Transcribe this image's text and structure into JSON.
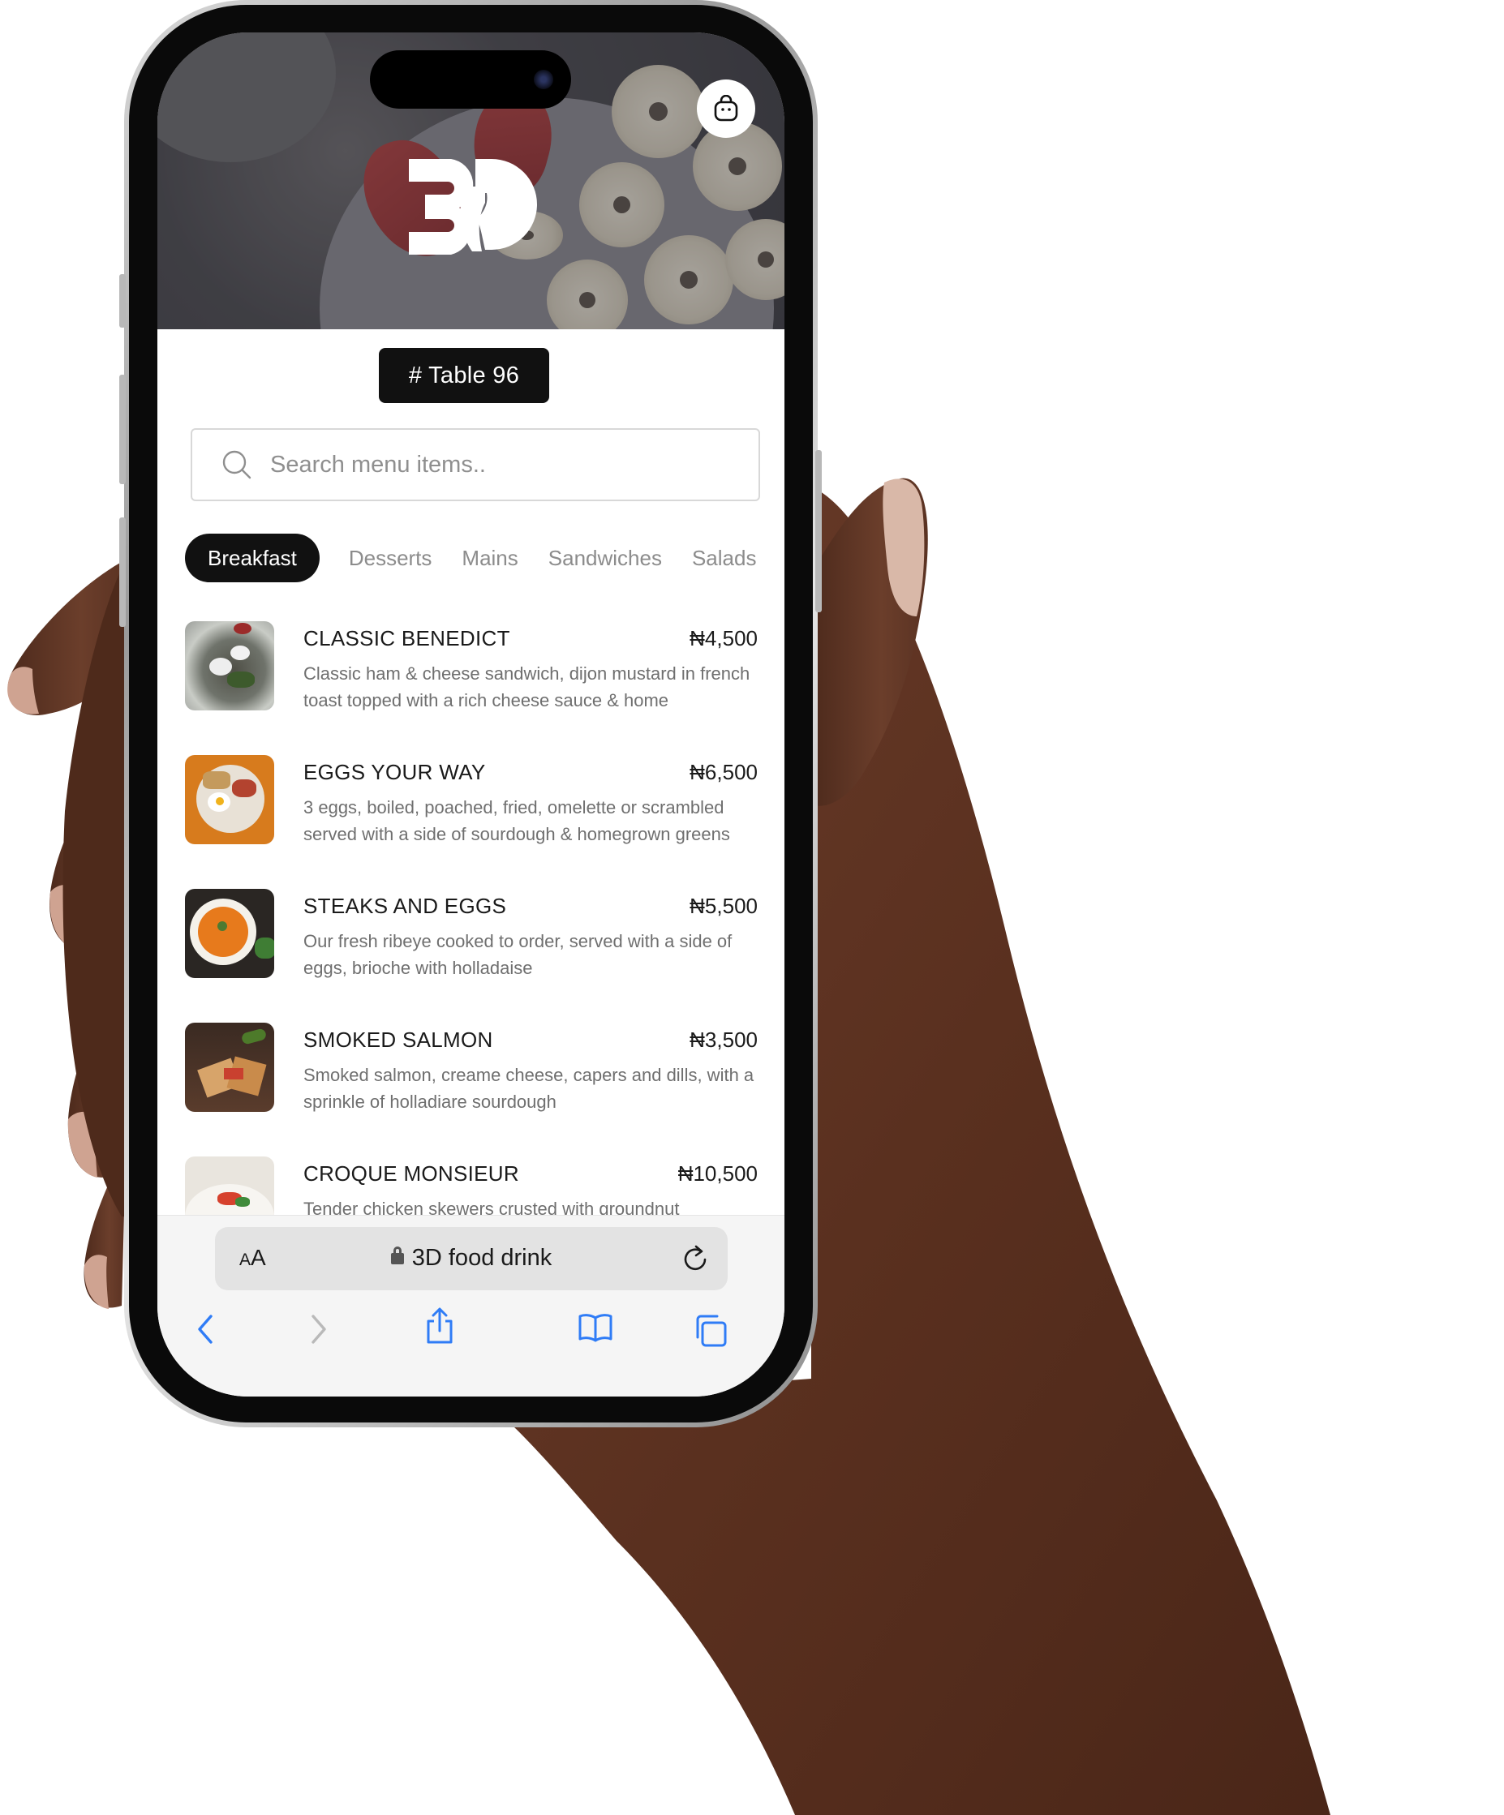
{
  "hero": {
    "logo": "3D"
  },
  "table": {
    "label": "# Table 96"
  },
  "search": {
    "placeholder": "Search menu items.."
  },
  "tabs": [
    {
      "label": "Breakfast",
      "active": true
    },
    {
      "label": "Desserts",
      "active": false
    },
    {
      "label": "Mains",
      "active": false
    },
    {
      "label": "Sandwiches",
      "active": false
    },
    {
      "label": "Salads",
      "active": false
    }
  ],
  "menu": [
    {
      "name": "CLASSIC BENEDICT",
      "price": "₦4,500",
      "desc": "Classic ham & cheese sandwich, dijon mustard in french toast topped with a rich cheese sauce & home"
    },
    {
      "name": "EGGS YOUR WAY",
      "price": "₦6,500",
      "desc": "3 eggs, boiled, poached, fried, omelette or scrambled served with a side of sourdough & homegrown greens"
    },
    {
      "name": "STEAKS AND EGGS",
      "price": "₦5,500",
      "desc": "Our fresh ribeye cooked to order, served with a side of eggs, brioche with holladaise"
    },
    {
      "name": "SMOKED SALMON",
      "price": "₦3,500",
      "desc": "Smoked salmon, creame cheese, capers and dills, with a sprinkle of holladiare sourdough"
    },
    {
      "name": "CROQUE MONSIEUR",
      "price": "₦10,500",
      "desc": "Tender chicken skewers crusted with groundnut"
    }
  ],
  "browser": {
    "aa_small": "A",
    "aa_large": "A",
    "url": "3D food drink"
  },
  "colors": {
    "accent": "#111111",
    "link_blue": "#2f7cf6"
  },
  "icons": [
    "shopping-bag-icon",
    "search-icon",
    "lock-icon",
    "reload-icon",
    "back-icon",
    "forward-icon",
    "share-icon",
    "bookmarks-icon",
    "tabs-icon"
  ]
}
